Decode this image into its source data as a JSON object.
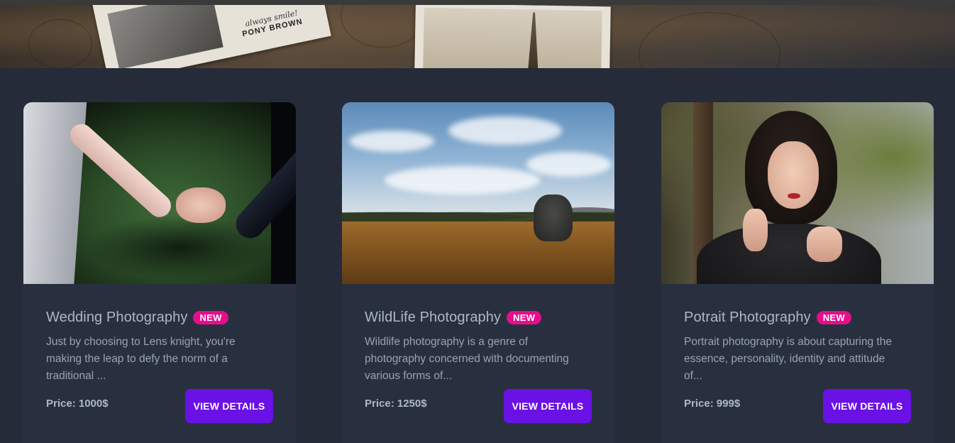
{
  "hero": {
    "postcard_caption_1": "always smile!",
    "postcard_caption_2": "PONY BROWN"
  },
  "colors": {
    "background": "#262b39",
    "card": "#283040",
    "badge": "#e50e8b",
    "button": "#6a11e6"
  },
  "cards": [
    {
      "title": "Wedding Photography",
      "badge": "NEW",
      "description": "Just by choosing to Lens knight, you're making the leap to defy the norm of a traditional ...",
      "price": "Price: 1000$",
      "button": "VIEW DETAILS",
      "image": "wedding-couple-holding-hands-image"
    },
    {
      "title": "WildLife Photography",
      "badge": "NEW",
      "description": "Wildlife photography is a genre of photography concerned with documenting various forms of...",
      "price": "Price: 1250$",
      "button": "VIEW DETAILS",
      "image": "elephant-savanna-image"
    },
    {
      "title": "Potrait Photography",
      "badge": "NEW",
      "description": "Portrait photography is about capturing the essence, personality, identity and attitude of...",
      "price": "Price: 999$",
      "button": "VIEW DETAILS",
      "image": "woman-portrait-image"
    }
  ]
}
